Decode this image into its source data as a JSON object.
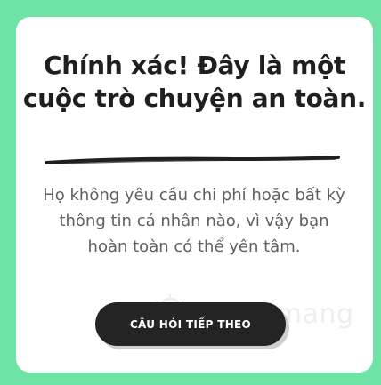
{
  "result": {
    "title": "Chính xác! Đây là một cuộc trò chuyện an toàn.",
    "explanation": "Họ không yêu cầu chi phí hoặc bất kỳ thông tin cá nhân nào, vì vậy bạn hoàn toàn có thể yên tâm.",
    "next_button_label": "CÂU HỎI TIẾP THEO"
  },
  "watermark": {
    "text": "uantrimang",
    "icon": "lightbulb-icon"
  },
  "colors": {
    "background": "#6fe3a6",
    "card": "#ffffff",
    "title_text": "#1f1f1f",
    "body_text": "#5f5f5f",
    "button": "#242424",
    "button_text": "#ffffff"
  }
}
